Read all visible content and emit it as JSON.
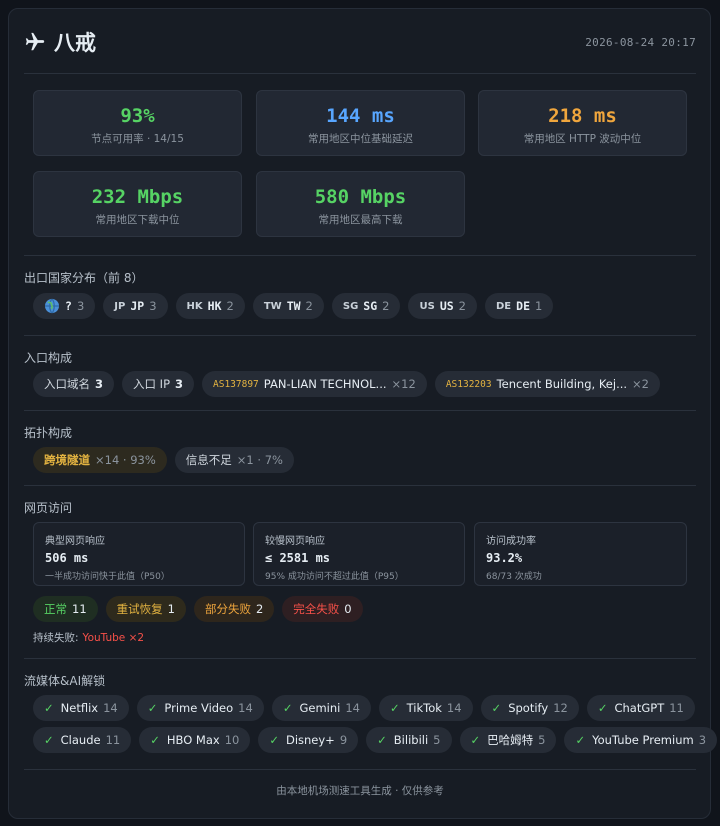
{
  "header": {
    "title": "八戒",
    "timestamp": "2026-08-24 20:17"
  },
  "stats": [
    {
      "value": "93%",
      "label": "节点可用率 · 14/15",
      "color": "green"
    },
    {
      "value": "144 ms",
      "label": "常用地区中位基础延迟",
      "color": "blue"
    },
    {
      "value": "218 ms",
      "label": "常用地区 HTTP 波动中位",
      "color": "orange"
    },
    {
      "value": "232 Mbps",
      "label": "常用地区下载中位",
      "color": "green"
    },
    {
      "value": "580 Mbps",
      "label": "常用地区最高下载",
      "color": "green"
    }
  ],
  "exit": {
    "title": "出口国家分布（前 8）",
    "items": [
      {
        "flag": "globe",
        "code": "?",
        "count": "3"
      },
      {
        "flag": "JP",
        "code": "JP",
        "count": "3"
      },
      {
        "flag": "HK",
        "code": "HK",
        "count": "2"
      },
      {
        "flag": "TW",
        "code": "TW",
        "count": "2"
      },
      {
        "flag": "SG",
        "code": "SG",
        "count": "2"
      },
      {
        "flag": "US",
        "code": "US",
        "count": "2"
      },
      {
        "flag": "DE",
        "code": "DE",
        "count": "1"
      }
    ]
  },
  "entry": {
    "title": "入口构成",
    "domain_label": "入口域名",
    "domain_count": "3",
    "ip_label": "入口 IP",
    "ip_count": "3",
    "asn": [
      {
        "as": "AS137897",
        "name": "PAN-LIAN TECHNOL...",
        "count": "×12"
      },
      {
        "as": "AS132203",
        "name": "Tencent Building, Kej...",
        "count": "×2"
      }
    ]
  },
  "topology": {
    "title": "拓扑构成",
    "items": [
      {
        "name": "跨境隧道",
        "detail": "×14 · 93%"
      },
      {
        "name": "信息不足",
        "detail": "×1 · 7%"
      }
    ]
  },
  "web": {
    "title": "网页访问",
    "boxes": [
      {
        "label": "典型网页响应",
        "value": "506 ms",
        "desc": "一半成功访问快于此值（P50）"
      },
      {
        "label": "较慢网页响应",
        "value": "≤ 2581 ms",
        "desc": "95% 成功访问不超过此值（P95）"
      },
      {
        "label": "访问成功率",
        "value": "93.2%",
        "desc": "68/73 次成功"
      }
    ],
    "status": [
      {
        "label": "正常",
        "count": "11"
      },
      {
        "label": "重试恢复",
        "count": "1"
      },
      {
        "label": "部分失败",
        "count": "2"
      },
      {
        "label": "完全失败",
        "count": "0"
      }
    ],
    "persist_label": "持续失败:",
    "persist_value": "YouTube ×2"
  },
  "streaming": {
    "title": "流媒体&AI解锁",
    "check": "✓",
    "row1": [
      {
        "name": "Netflix",
        "count": "14"
      },
      {
        "name": "Prime Video",
        "count": "14"
      },
      {
        "name": "Gemini",
        "count": "14"
      },
      {
        "name": "TikTok",
        "count": "14"
      },
      {
        "name": "Spotify",
        "count": "12"
      },
      {
        "name": "ChatGPT",
        "count": "11"
      }
    ],
    "row2": [
      {
        "name": "Claude",
        "count": "11"
      },
      {
        "name": "HBO Max",
        "count": "10"
      },
      {
        "name": "Disney+",
        "count": "9"
      },
      {
        "name": "Bilibili",
        "count": "5"
      },
      {
        "name": "巴哈姆特",
        "count": "5"
      },
      {
        "name": "YouTube Premium",
        "count": "3"
      }
    ]
  },
  "footer": {
    "text": "由本地机场测速工具生成 · 仅供参考"
  }
}
